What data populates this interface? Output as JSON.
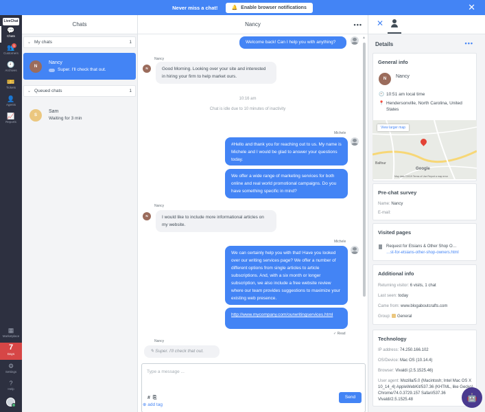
{
  "banner": {
    "message": "Never miss a chat!",
    "button_label": "Enable browser notifications",
    "close": "✕"
  },
  "rail": {
    "logo": "LiveChat",
    "items": [
      {
        "label": "Chats",
        "icon": "💬"
      },
      {
        "label": "Customers",
        "icon": "👥",
        "badge": "1"
      },
      {
        "label": "Archives",
        "icon": "🕘"
      },
      {
        "label": "Tickets",
        "icon": "🎫"
      },
      {
        "label": "Agents",
        "icon": "👤"
      },
      {
        "label": "Reports",
        "icon": "📈"
      },
      {
        "label": "Marketplace",
        "icon": "▦"
      },
      {
        "label": "Settings",
        "icon": "⚙"
      },
      {
        "label": "Help",
        "icon": "?"
      }
    ],
    "days_count": "7",
    "days_label": "Days"
  },
  "chat_list": {
    "title": "Chats",
    "my_chats": {
      "label": "My chats",
      "count": "1"
    },
    "queued_chats": {
      "label": "Queued chats",
      "count": "1"
    },
    "items": [
      {
        "initial": "N",
        "name": "Nancy",
        "preview": "Super. I'll check that out."
      },
      {
        "initial": "S",
        "name": "Sam",
        "preview": "Waiting for 3 min"
      }
    ]
  },
  "chat": {
    "title": "Nancy",
    "messages": [
      {
        "text": "Welcome back! Can I help you with anything?"
      },
      {
        "sender": "Nancy",
        "text": "Good Morning. Looking over your site and interested in hiring your firm to help market ours."
      },
      {
        "text": "10:16 am"
      },
      {
        "text": "Chat is idle due to 10 minutes of inactivity"
      },
      {
        "sender": "Michele",
        "text": "#Hello and thank you for reaching out to us. My name is Michele and I would be glad to answer your questions today."
      },
      {
        "text": "We offer a wide range of marketing services for both online and real world promotional campaigns. Do you have something specific in mind?"
      },
      {
        "sender": "Nancy",
        "text": "I would like to include more informational articles on my website."
      },
      {
        "sender": "Michele",
        "text": "We can certainly help you with that! Have you looked over our writing services page? We offer a number of different options from single articles to article subscriptions. And, with a six month or longer subscription, we also include a free website review where our team provides suggestions to maximize your existing web presence."
      },
      {
        "text": "http://www.mycompany.com/ourwritingservices.html"
      },
      {
        "text": "✓ Read"
      },
      {
        "sender": "Nancy",
        "text": "Super. I'll check that out."
      }
    ],
    "composer": {
      "placeholder": "Type a message ...",
      "hash": "#",
      "clip": "⎘",
      "send": "Send"
    },
    "add_tag": "add tag",
    "more": "•••"
  },
  "details": {
    "title": "Details",
    "more": "•••",
    "general": {
      "title": "General info",
      "initial": "N",
      "name": "Nancy",
      "local_time": "10:51 am local time",
      "location": "Hendersonville, North Carolina, United States",
      "map": {
        "view_larger": "View larger map",
        "town": "Balfour",
        "brand": "Google",
        "footer": "Map data ©2019   Terms of Use   Report a map error"
      }
    },
    "prechat": {
      "title": "Pre-chat survey",
      "name_k": "Name:",
      "name_v": "Nancy",
      "email_k": "E-mail:"
    },
    "visited": {
      "title": "Visited pages",
      "page_title": "Request for Etsians & Other Shop O…",
      "page_url": "…st-for-etsians-other-shop-owners.html"
    },
    "additional": {
      "title": "Additional info",
      "returning_k": "Returning visitor:",
      "returning_v": "6 visits, 1 chat",
      "last_seen_k": "Last seen:",
      "last_seen_v": "today",
      "came_from_k": "Came from:",
      "came_from_v": "www.blogaboutcrafts.com",
      "group_k": "Group:",
      "group_v": "General"
    },
    "technology": {
      "title": "Technology",
      "ip_k": "IP address:",
      "ip_v": "74.250.166.102",
      "os_k": "OS/Device:",
      "os_v": "Mac OS (10.14.4)",
      "browser_k": "Browser:",
      "browser_v": "Vivaldi (2.5.1525.46)",
      "ua_k": "User agent:",
      "ua_v": "Mozilla/5.0 (Macintosh; Intel Mac OS X 10_14_4) AppleWebKit/537.36 (KHTML, like Gecko) Chrome/74.0.3729.157 Safari/537.36 Vivaldi/2.5.1525.48"
    }
  }
}
